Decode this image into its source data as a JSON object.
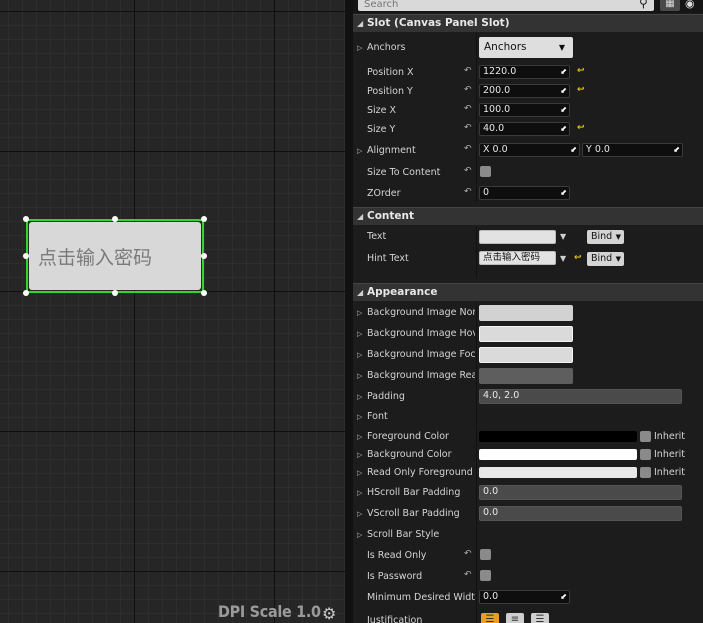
{
  "canvas": {
    "widget_hint_text": "点击输入密码",
    "dpi_label": "DPI Scale 1.0"
  },
  "search": {
    "placeholder": "Search"
  },
  "categories": {
    "slot": "Slot (Canvas Panel Slot)",
    "content": "Content",
    "appearance": "Appearance"
  },
  "slot": {
    "anchors_label": "Anchors",
    "anchors_button": "Anchors",
    "position_x_label": "Position X",
    "position_x_value": "1220.0",
    "position_y_label": "Position Y",
    "position_y_value": "200.0",
    "size_x_label": "Size X",
    "size_x_value": "100.0",
    "size_y_label": "Size Y",
    "size_y_value": "40.0",
    "alignment_label": "Alignment",
    "alignment_x": "X  0.0",
    "alignment_y": "Y  0.0",
    "size_to_content_label": "Size To Content",
    "zorder_label": "ZOrder",
    "zorder_value": "0"
  },
  "content": {
    "text_label": "Text",
    "text_value": "",
    "hint_text_label": "Hint Text",
    "hint_text_value": "点击输入密码",
    "bind_label": "Bind"
  },
  "appearance": {
    "bg_image_normal_label": "Background Image Normal",
    "bg_image_hovered_label": "Background Image Hovered",
    "bg_image_focused_label": "Background Image Focused",
    "bg_image_readonly_label": "Background Image ReadOnly",
    "padding_label": "Padding",
    "padding_value": "4.0, 2.0",
    "font_label": "Font",
    "foreground_color_label": "Foreground Color",
    "background_color_label": "Background Color",
    "readonly_fg_color_label": "Read Only Foreground Color",
    "inherit_label": "Inherit",
    "hscroll_label": "HScroll Bar Padding",
    "hscroll_value": "0.0",
    "vscroll_label": "VScroll Bar Padding",
    "vscroll_value": "0.0",
    "scroll_style_label": "Scroll Bar Style",
    "is_read_only_label": "Is Read Only",
    "is_password_label": "Is Password",
    "min_width_label": "Minimum Desired Width",
    "min_width_value": "0.0",
    "justification_label": "Justification"
  },
  "colors": {
    "selection_outline": "#33d42f",
    "foreground_color": "#000000",
    "background_color": "#ffffff",
    "readonly_fg_color": "#e8e8e8",
    "accent": "#e3c400"
  }
}
